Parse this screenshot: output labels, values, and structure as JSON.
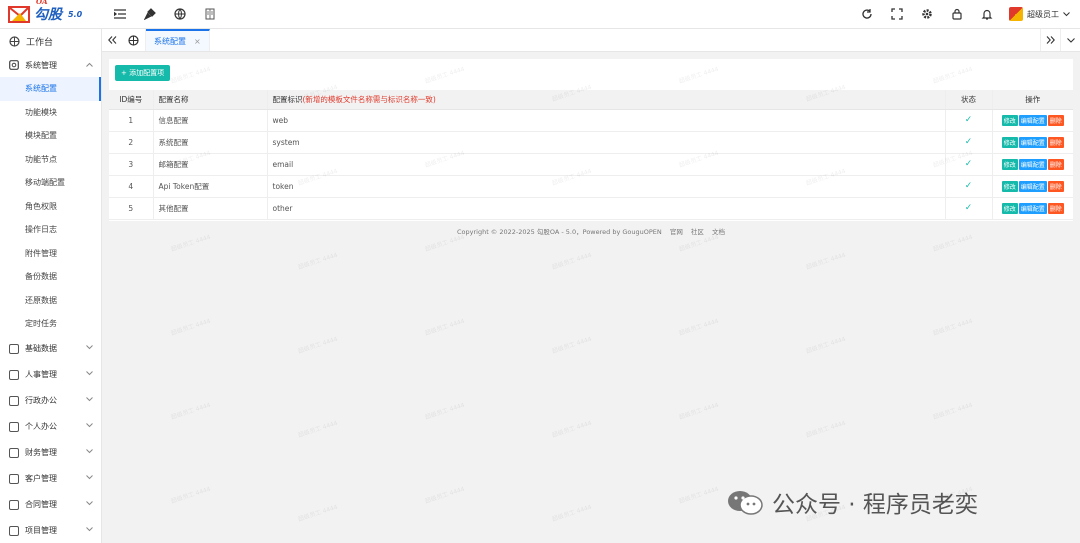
{
  "app": {
    "logo_sub": "OA",
    "logo_text": "勾股",
    "logo_version": "5.0",
    "user_name": "超级员工"
  },
  "sidebar": {
    "workbench": "工作台",
    "groups": [
      {
        "label": "系统管理",
        "expanded": true
      },
      {
        "label": "基础数据"
      },
      {
        "label": "人事管理"
      },
      {
        "label": "行政办公"
      },
      {
        "label": "个人办公"
      },
      {
        "label": "财务管理"
      },
      {
        "label": "客户管理"
      },
      {
        "label": "合同管理"
      },
      {
        "label": "项目管理"
      }
    ],
    "system_items": [
      "系统配置",
      "功能模块",
      "模块配置",
      "功能节点",
      "移动端配置",
      "角色权限",
      "操作日志",
      "附件管理",
      "备份数据",
      "还原数据",
      "定时任务"
    ]
  },
  "tabs": {
    "active": "系统配置"
  },
  "page": {
    "add_button": "+ 添加配置项",
    "columns": {
      "id": "ID编号",
      "name": "配置名称",
      "key": "配置标识",
      "key_hint": "(新增的模板文件名称需与标识名称一致)",
      "status": "状态",
      "ops": "操作"
    },
    "op_labels": {
      "edit": "修改",
      "config": "编辑配置",
      "delete": "删除"
    },
    "rows": [
      {
        "id": "1",
        "name": "信息配置",
        "key": "web"
      },
      {
        "id": "2",
        "name": "系统配置",
        "key": "system"
      },
      {
        "id": "3",
        "name": "邮箱配置",
        "key": "email"
      },
      {
        "id": "4",
        "name": "Api Token配置",
        "key": "token"
      },
      {
        "id": "5",
        "name": "其他配置",
        "key": "other"
      }
    ]
  },
  "footer": {
    "copyright": "Copyright © 2022-2025 勾股OA - 5.0，Powered by GouguOPEN",
    "links": [
      "官网",
      "社区",
      "文档"
    ]
  },
  "watermark": {
    "text": "超级员工 4444"
  },
  "overlay": {
    "text": "公众号 · 程序员老奕"
  }
}
